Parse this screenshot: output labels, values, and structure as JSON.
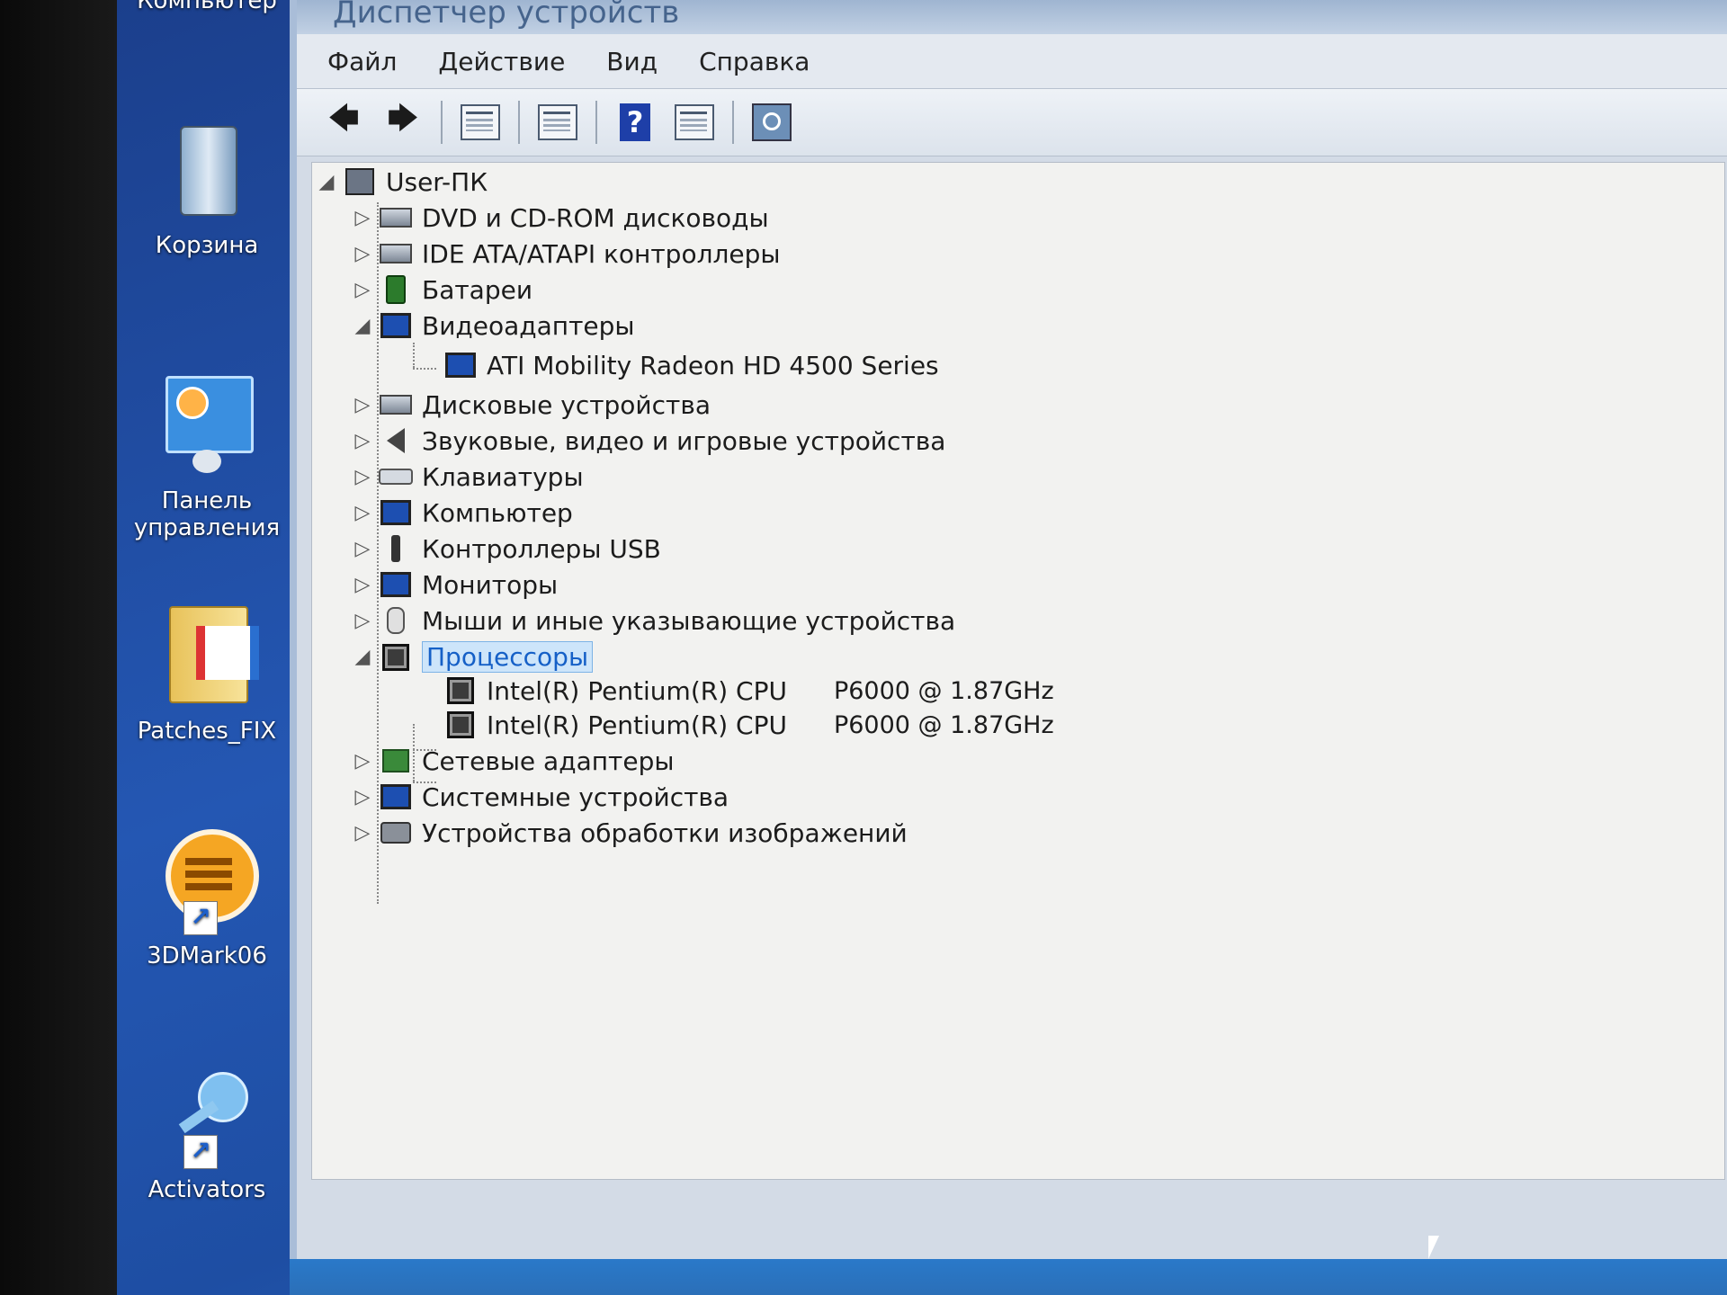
{
  "window": {
    "title": "Диспетчер устройств"
  },
  "menu": [
    "Файл",
    "Действие",
    "Вид",
    "Справка"
  ],
  "desktop_icons": [
    {
      "label": "Компьютер",
      "icon": "computer-icon"
    },
    {
      "label": "Корзина",
      "icon": "recycle-bin-icon"
    },
    {
      "label": "Панель управления",
      "icon": "control-panel-icon"
    },
    {
      "label": "Patches_FIX",
      "icon": "folder-icon"
    },
    {
      "label": "3DMark06",
      "icon": "3dmark-icon"
    },
    {
      "label": "Activators",
      "icon": "activators-icon"
    }
  ],
  "tree": {
    "root": "User-ПК",
    "categories": [
      {
        "label": "DVD и CD-ROM дисководы"
      },
      {
        "label": "IDE ATA/ATAPI контроллеры"
      },
      {
        "label": "Батареи"
      },
      {
        "label": "Видеоадаптеры",
        "children": [
          "ATI Mobility Radeon HD 4500 Series"
        ]
      },
      {
        "label": "Дисковые устройства"
      },
      {
        "label": "Звуковые, видео и игровые устройства"
      },
      {
        "label": "Клавиатуры"
      },
      {
        "label": "Компьютер"
      },
      {
        "label": "Контроллеры USB"
      },
      {
        "label": "Мониторы"
      },
      {
        "label": "Мыши и иные указывающие устройства"
      },
      {
        "label": "Процессоры",
        "selected": true,
        "children": [
          {
            "name": "Intel(R) Pentium(R) CPU",
            "model": "P6000  @ 1.87GHz"
          },
          {
            "name": "Intel(R) Pentium(R) CPU",
            "model": "P6000  @ 1.87GHz"
          }
        ]
      },
      {
        "label": "Сетевые адаптеры"
      },
      {
        "label": "Системные устройства"
      },
      {
        "label": "Устройства обработки изображений"
      }
    ]
  }
}
